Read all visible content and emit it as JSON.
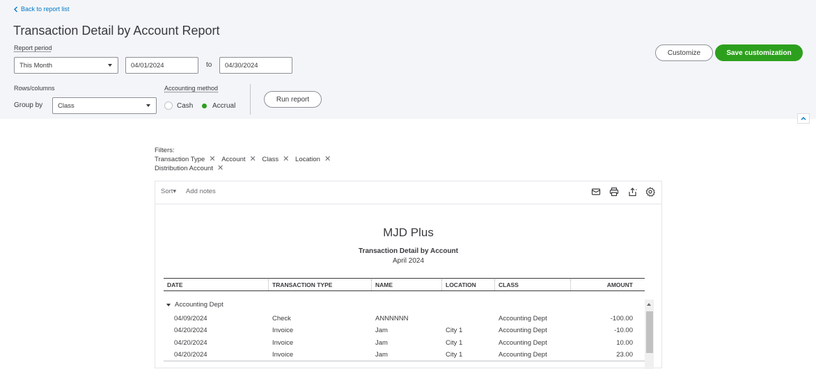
{
  "header": {
    "back_label": "Back to report list",
    "title": "Transaction Detail by Account Report"
  },
  "report_period": {
    "label": "Report period",
    "period_value": "This Month",
    "start_date": "04/01/2024",
    "to_label": "to",
    "end_date": "04/30/2024"
  },
  "rows_columns": {
    "label": "Rows/columns",
    "group_by_label": "Group by",
    "group_by_value": "Class"
  },
  "accounting_method": {
    "label": "Accounting method",
    "options": [
      "Cash",
      "Accrual"
    ],
    "selected": "Accrual"
  },
  "buttons": {
    "run_report": "Run report",
    "customize": "Customize",
    "save_customization": "Save customization"
  },
  "filters": {
    "label": "Filters:",
    "items": [
      "Transaction Type",
      "Account",
      "Class",
      "Location",
      "Distribution Account"
    ]
  },
  "toolbar": {
    "sort_label": "Sort▾",
    "add_notes_label": "Add notes",
    "icons": [
      "email-icon",
      "print-icon",
      "export-icon",
      "settings-icon"
    ]
  },
  "report": {
    "company": "MJD Plus",
    "title": "Transaction Detail by Account",
    "date_range": "April 2024",
    "columns": [
      "DATE",
      "TRANSACTION TYPE",
      "NAME",
      "LOCATION",
      "CLASS",
      "AMOUNT"
    ],
    "group_name": "Accounting Dept",
    "rows": [
      {
        "date": "04/09/2024",
        "type": "Check",
        "name": "ANNNNNN",
        "location": "",
        "class": "Accounting Dept",
        "amount": "-100.00"
      },
      {
        "date": "04/20/2024",
        "type": "Invoice",
        "name": "Jam",
        "location": "City 1",
        "class": "Accounting Dept",
        "amount": "-10.00"
      },
      {
        "date": "04/20/2024",
        "type": "Invoice",
        "name": "Jam",
        "location": "City 1",
        "class": "Accounting Dept",
        "amount": "10.00"
      },
      {
        "date": "04/20/2024",
        "type": "Invoice",
        "name": "Jam",
        "location": "City 1",
        "class": "Accounting Dept",
        "amount": "23.00"
      }
    ]
  },
  "colors": {
    "accent_green": "#2ca01c",
    "link_blue": "#0077c5",
    "text": "#393a3d",
    "top_bg": "#f4f5f8"
  }
}
